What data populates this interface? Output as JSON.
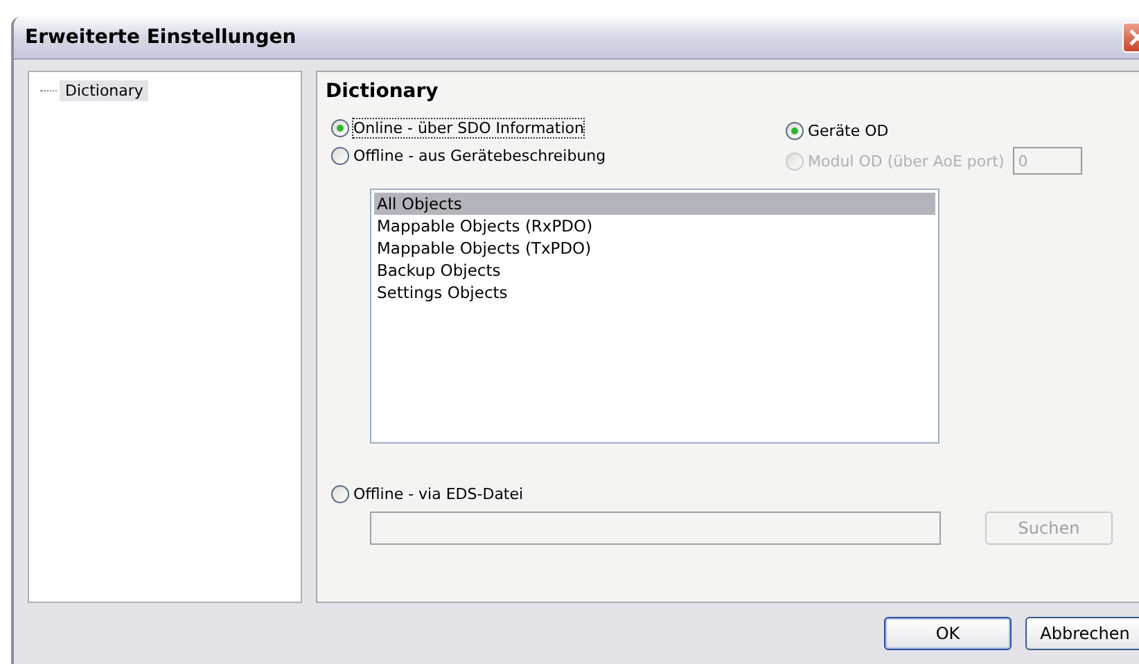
{
  "window": {
    "title": "Erweiterte Einstellungen"
  },
  "tree": {
    "items": [
      {
        "label": "Dictionary",
        "selected": true
      }
    ]
  },
  "panel": {
    "heading": "Dictionary",
    "source_radios": [
      {
        "label": "Online - über SDO Information",
        "selected": true,
        "focused": true
      },
      {
        "label": "Offline - aus Gerätebeschreibung",
        "selected": false,
        "focused": false
      }
    ],
    "od_radios": [
      {
        "label": "Geräte OD",
        "selected": true,
        "disabled": false
      },
      {
        "label": "Modul OD (über AoE port)",
        "selected": false,
        "disabled": true
      }
    ],
    "port_field": {
      "value": "0",
      "disabled": true
    },
    "object_list": [
      {
        "label": "All Objects",
        "selected": true
      },
      {
        "label": "Mappable Objects (RxPDO)",
        "selected": false
      },
      {
        "label": "Mappable Objects (TxPDO)",
        "selected": false
      },
      {
        "label": "Backup Objects",
        "selected": false
      },
      {
        "label": "Settings Objects",
        "selected": false
      }
    ],
    "eds_radio": {
      "label": "Offline - via EDS-Datei",
      "selected": false
    },
    "eds_field": {
      "disabled": true
    },
    "search_button": {
      "label": "Suchen",
      "disabled": true
    }
  },
  "buttons": [
    {
      "label": "OK",
      "kind": "default"
    },
    {
      "label": "Abbrechen",
      "kind": "normal"
    }
  ]
}
